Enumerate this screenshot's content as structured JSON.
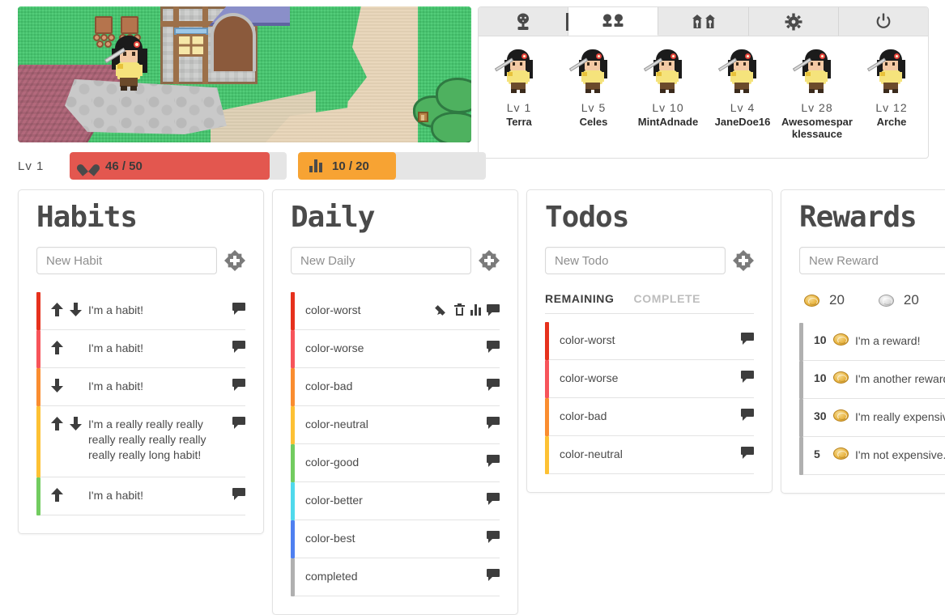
{
  "user": {
    "level_label": "Lv  1",
    "hp": {
      "current": 46,
      "max": 50,
      "text": "46 / 50",
      "percent": 92,
      "color": "#e3574f"
    },
    "xp": {
      "current": 10,
      "max": 20,
      "text": "10 / 20",
      "percent": 52,
      "color": "#f7a333"
    }
  },
  "party": {
    "tabs": [
      {
        "icon": "single-avatar-icon",
        "active": false
      },
      {
        "icon": "two-people-icon",
        "active": true
      },
      {
        "icon": "two-houses-icon",
        "active": false
      },
      {
        "icon": "gear-icon",
        "active": false
      },
      {
        "icon": "power-icon",
        "active": false
      }
    ],
    "members": [
      {
        "level": "Lv  1",
        "name": "Terra"
      },
      {
        "level": "Lv  5",
        "name": "Celes"
      },
      {
        "level": "Lv  10",
        "name": "MintAdnade"
      },
      {
        "level": "Lv  4",
        "name": "JaneDoe16"
      },
      {
        "level": "Lv  28",
        "name": "Awesomesparklessauce"
      },
      {
        "level": "Lv  12",
        "name": "Arche"
      }
    ]
  },
  "colors": {
    "worst": "#e6311d",
    "worse": "#f7545a",
    "bad": "#fa8d30",
    "neutral": "#fdc134",
    "good": "#72cc60",
    "better": "#50d9ec",
    "best": "#4f80f0",
    "grey": "#b0b0b0"
  },
  "columns": {
    "habits": {
      "title": "Habits",
      "placeholder": "New Habit",
      "add_label": "+",
      "items": [
        {
          "text": "I'm a habit!",
          "color": "#e6311d",
          "up": true,
          "down": true
        },
        {
          "text": "I'm a habit!",
          "color": "#f7545a",
          "up": true,
          "down": false
        },
        {
          "text": "I'm a habit!",
          "color": "#fa8d30",
          "up": false,
          "down": true
        },
        {
          "text": "I'm a really really really really really really really really really long habit!",
          "color": "#fdc134",
          "up": true,
          "down": true
        },
        {
          "text": "I'm a habit!",
          "color": "#72cc60",
          "up": true,
          "down": false
        }
      ]
    },
    "daily": {
      "title": "Daily",
      "placeholder": "New Daily",
      "add_label": "+",
      "items": [
        {
          "text": "color-worst",
          "color": "#e6311d",
          "hovered": true
        },
        {
          "text": "color-worse",
          "color": "#f7545a",
          "hovered": false
        },
        {
          "text": "color-bad",
          "color": "#fa8d30",
          "hovered": false
        },
        {
          "text": "color-neutral",
          "color": "#fdc134",
          "hovered": false
        },
        {
          "text": "color-good",
          "color": "#72cc60",
          "hovered": false
        },
        {
          "text": "color-better",
          "color": "#50d9ec",
          "hovered": false
        },
        {
          "text": "color-best",
          "color": "#4f80f0",
          "hovered": false
        },
        {
          "text": "completed",
          "color": "#b0b0b0",
          "hovered": false
        }
      ]
    },
    "todos": {
      "title": "Todos",
      "placeholder": "New Todo",
      "add_label": "+",
      "tabs": [
        {
          "label": "REMAINING",
          "active": true
        },
        {
          "label": "COMPLETE",
          "active": false
        }
      ],
      "items": [
        {
          "text": "color-worst",
          "color": "#e6311d"
        },
        {
          "text": "color-worse",
          "color": "#f7545a"
        },
        {
          "text": "color-bad",
          "color": "#fa8d30"
        },
        {
          "text": "color-neutral",
          "color": "#fdc134"
        }
      ]
    },
    "rewards": {
      "title": "Rewards",
      "placeholder": "New Reward",
      "add_label": "+",
      "balance": [
        {
          "currency": "gold-coin-icon",
          "amount": "20"
        },
        {
          "currency": "silver-coin-icon",
          "amount": "20"
        }
      ],
      "items": [
        {
          "cost": "10",
          "text": "I'm a reward!",
          "color": "#b0b0b0"
        },
        {
          "cost": "10",
          "text": "I'm another reward!",
          "color": "#b0b0b0"
        },
        {
          "cost": "30",
          "text": "I'm really expensive!",
          "color": "#b0b0b0"
        },
        {
          "cost": "5",
          "text": "I'm not expensive...",
          "color": "#b0b0b0"
        }
      ]
    }
  }
}
